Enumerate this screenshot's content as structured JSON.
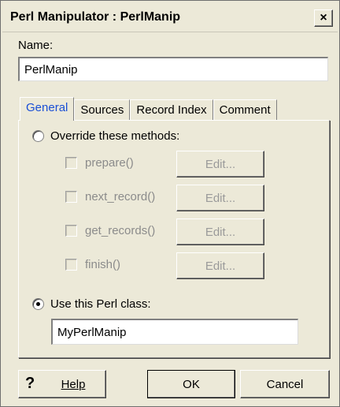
{
  "window": {
    "title": "Perl Manipulator : PerlManip",
    "close_symbol": "×"
  },
  "name": {
    "label": "Name:",
    "value": "PerlManip"
  },
  "tabs": [
    {
      "label": "General",
      "active": true
    },
    {
      "label": "Sources",
      "active": false
    },
    {
      "label": "Record Index",
      "active": false
    },
    {
      "label": "Comment",
      "active": false
    }
  ],
  "general": {
    "override_label": "Override these methods:",
    "override_selected": false,
    "methods": [
      {
        "label": "prepare()",
        "checked": false,
        "enabled": false,
        "edit_label": "Edit..."
      },
      {
        "label": "next_record()",
        "checked": false,
        "enabled": false,
        "edit_label": "Edit..."
      },
      {
        "label": "get_records()",
        "checked": false,
        "enabled": false,
        "edit_label": "Edit..."
      },
      {
        "label": "finish()",
        "checked": false,
        "enabled": false,
        "edit_label": "Edit..."
      }
    ],
    "use_class_label": "Use this Perl class:",
    "use_class_selected": true,
    "class_value": "MyPerlManip"
  },
  "buttons": {
    "help_icon": "?",
    "help": "Help",
    "ok": "OK",
    "cancel": "Cancel"
  },
  "colors": {
    "dialog_background": "#ece9d8",
    "active_tab_text": "#1a4fd6",
    "disabled_text": "#8b8b8b"
  }
}
